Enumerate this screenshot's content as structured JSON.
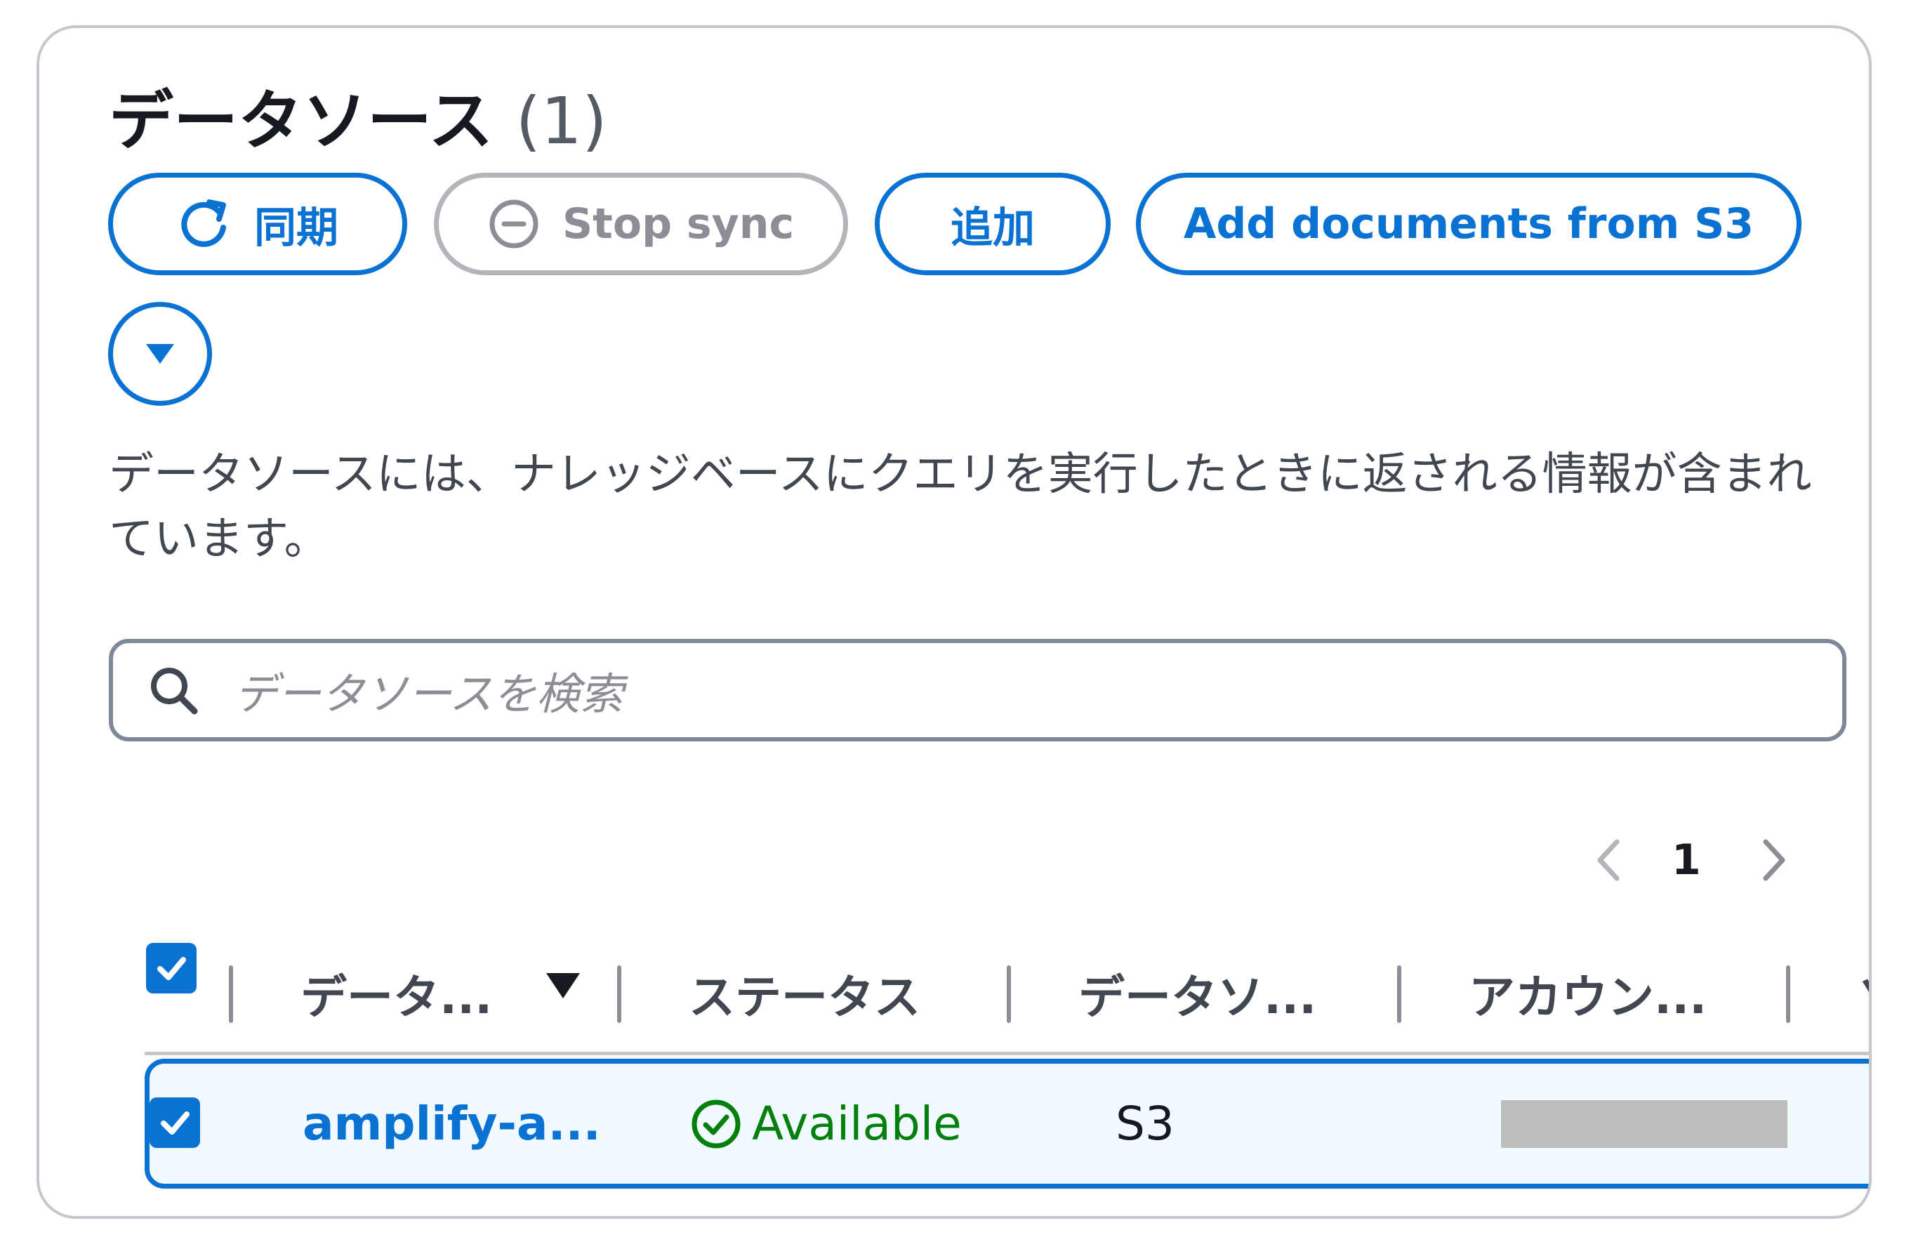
{
  "header": {
    "title": "データソース",
    "count": "(1)"
  },
  "actions": {
    "sync_label": "同期",
    "stop_sync_label": "Stop sync",
    "add_label": "追加",
    "add_s3_label": "Add documents from S3"
  },
  "description": "データソースには、ナレッジベースにクエリを実行したときに返される情報が含まれています。",
  "search": {
    "placeholder": "データソースを検索"
  },
  "pagination": {
    "current_page": "1"
  },
  "table": {
    "columns": [
      "データ...",
      "ステータス",
      "データソ...",
      "アカウン...",
      "ソ"
    ],
    "rows": [
      {
        "name": "amplify-a...",
        "status": "Available",
        "source_type": "S3",
        "account": "",
        "link_partial": "s3"
      }
    ]
  },
  "colors": {
    "accent": "#0972d3",
    "success": "#037f0c",
    "disabled": "#8d8d96"
  },
  "icons": [
    "refresh-icon",
    "stop-icon",
    "caret-down-icon",
    "search-icon",
    "chevron-left-icon",
    "chevron-right-icon",
    "checkmark-icon",
    "status-available-icon",
    "sort-desc-icon"
  ]
}
